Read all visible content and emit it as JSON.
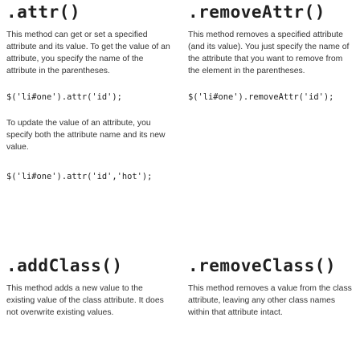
{
  "attr": {
    "title": ".attr()",
    "description": "This method can get or set a specified attribute and its value. To get the value of an attribute, you specify the name of the attribute in the parentheses.",
    "example_get": "$('li#one').attr('id');",
    "note": "To update the value of an attribute, you specify both the attribute name and its new value.",
    "example_set": "$('li#one').attr('id','hot');"
  },
  "removeAttr": {
    "title": ".removeAttr()",
    "description": "This method removes a specified attribute (and its value). You just specify the name of the attribute that you want to remove from the element in the parentheses.",
    "example": "$('li#one').removeAttr('id');"
  },
  "addClass": {
    "title": ".addClass()",
    "description": "This method adds a new value to the existing value of the class attribute. It does not overwrite existing values."
  },
  "removeClass": {
    "title": ".removeClass()",
    "description": "This method removes a value from the class attribute, leaving any other class names within that attribute intact."
  }
}
